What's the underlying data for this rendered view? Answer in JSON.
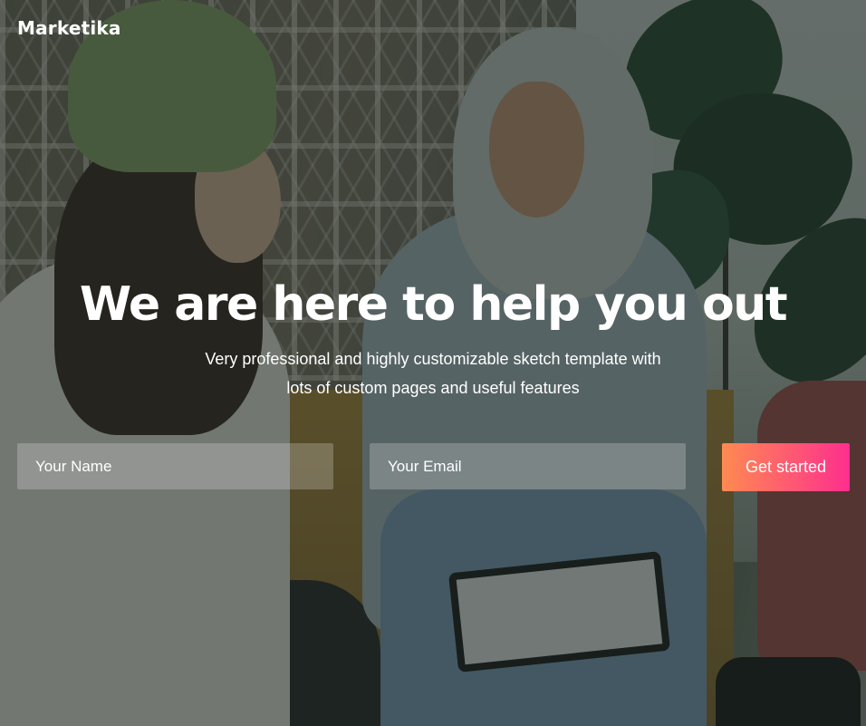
{
  "brand": {
    "name": "Marketika"
  },
  "hero": {
    "headline": "We are here to help you out",
    "subtitle_line1": "Very professional and highly customizable sketch template with",
    "subtitle_line2": "lots of custom pages and useful features",
    "background_image": "photo of two women talking on a bench",
    "overlay_color": "#16201A"
  },
  "signup_form": {
    "name_placeholder": "Your Name",
    "email_placeholder": "Your Email",
    "submit_label": "Get started",
    "submit_gradient": [
      "#FF8A52",
      "#FE2F8E"
    ]
  }
}
